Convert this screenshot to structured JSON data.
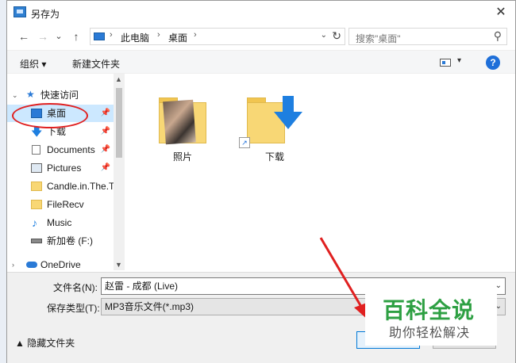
{
  "window": {
    "title": "另存为",
    "close_glyph": "✕"
  },
  "address": {
    "back_glyph": "←",
    "forward_glyph": "→",
    "recent_glyph": "⌄",
    "up_glyph": "↑",
    "segments": [
      "此电脑",
      "桌面"
    ],
    "sep_glyph": "›",
    "dropdown_glyph": "⌄",
    "refresh_glyph": "↻"
  },
  "search": {
    "placeholder": "搜索\"桌面\"",
    "icon_glyph": "⚲"
  },
  "toolbar": {
    "organize_label": "组织 ▾",
    "new_folder_label": "新建文件夹",
    "view_dd_glyph": "▾",
    "help_glyph": "?"
  },
  "nav": {
    "quick_access_label": "快速访问",
    "items": [
      {
        "label": "桌面",
        "icon": "desktop-icon",
        "pinned": true
      },
      {
        "label": "下载",
        "icon": "download-icon",
        "pinned": true
      },
      {
        "label": "Documents",
        "icon": "documents-icon",
        "pinned": true
      },
      {
        "label": "Pictures",
        "icon": "pictures-icon",
        "pinned": true
      },
      {
        "label": "Candle.in.The.T",
        "icon": "folder-icon",
        "pinned": false
      },
      {
        "label": "FileRecv",
        "icon": "folder-icon",
        "pinned": false
      },
      {
        "label": "Music",
        "icon": "music-icon",
        "pinned": false
      },
      {
        "label": "新加卷 (F:)",
        "icon": "drive-icon",
        "pinned": false
      }
    ],
    "onedrive_label": "OneDrive",
    "pin_glyph": "📌",
    "collapse_glyph": "⌄",
    "expand_glyph": "›"
  },
  "files": [
    {
      "name": "照片",
      "type": "photo-folder"
    },
    {
      "name": "下载",
      "type": "download-folder"
    }
  ],
  "form": {
    "filename_label": "文件名(N):",
    "filename_value": "赵雷 - 成都 (Live)",
    "filetype_label": "保存类型(T):",
    "filetype_value": "MP3音乐文件(*.mp3)",
    "dropdown_glyph": "⌄"
  },
  "footer": {
    "hide_folders_label": "▲  隐藏文件夹"
  },
  "watermark": {
    "title": "百科全说",
    "subtitle": "助你轻松解决"
  },
  "colors": {
    "accent": "#0078d7",
    "selected": "#cce8ff",
    "annotation": "#e02020",
    "watermark_green": "#2ea043"
  }
}
